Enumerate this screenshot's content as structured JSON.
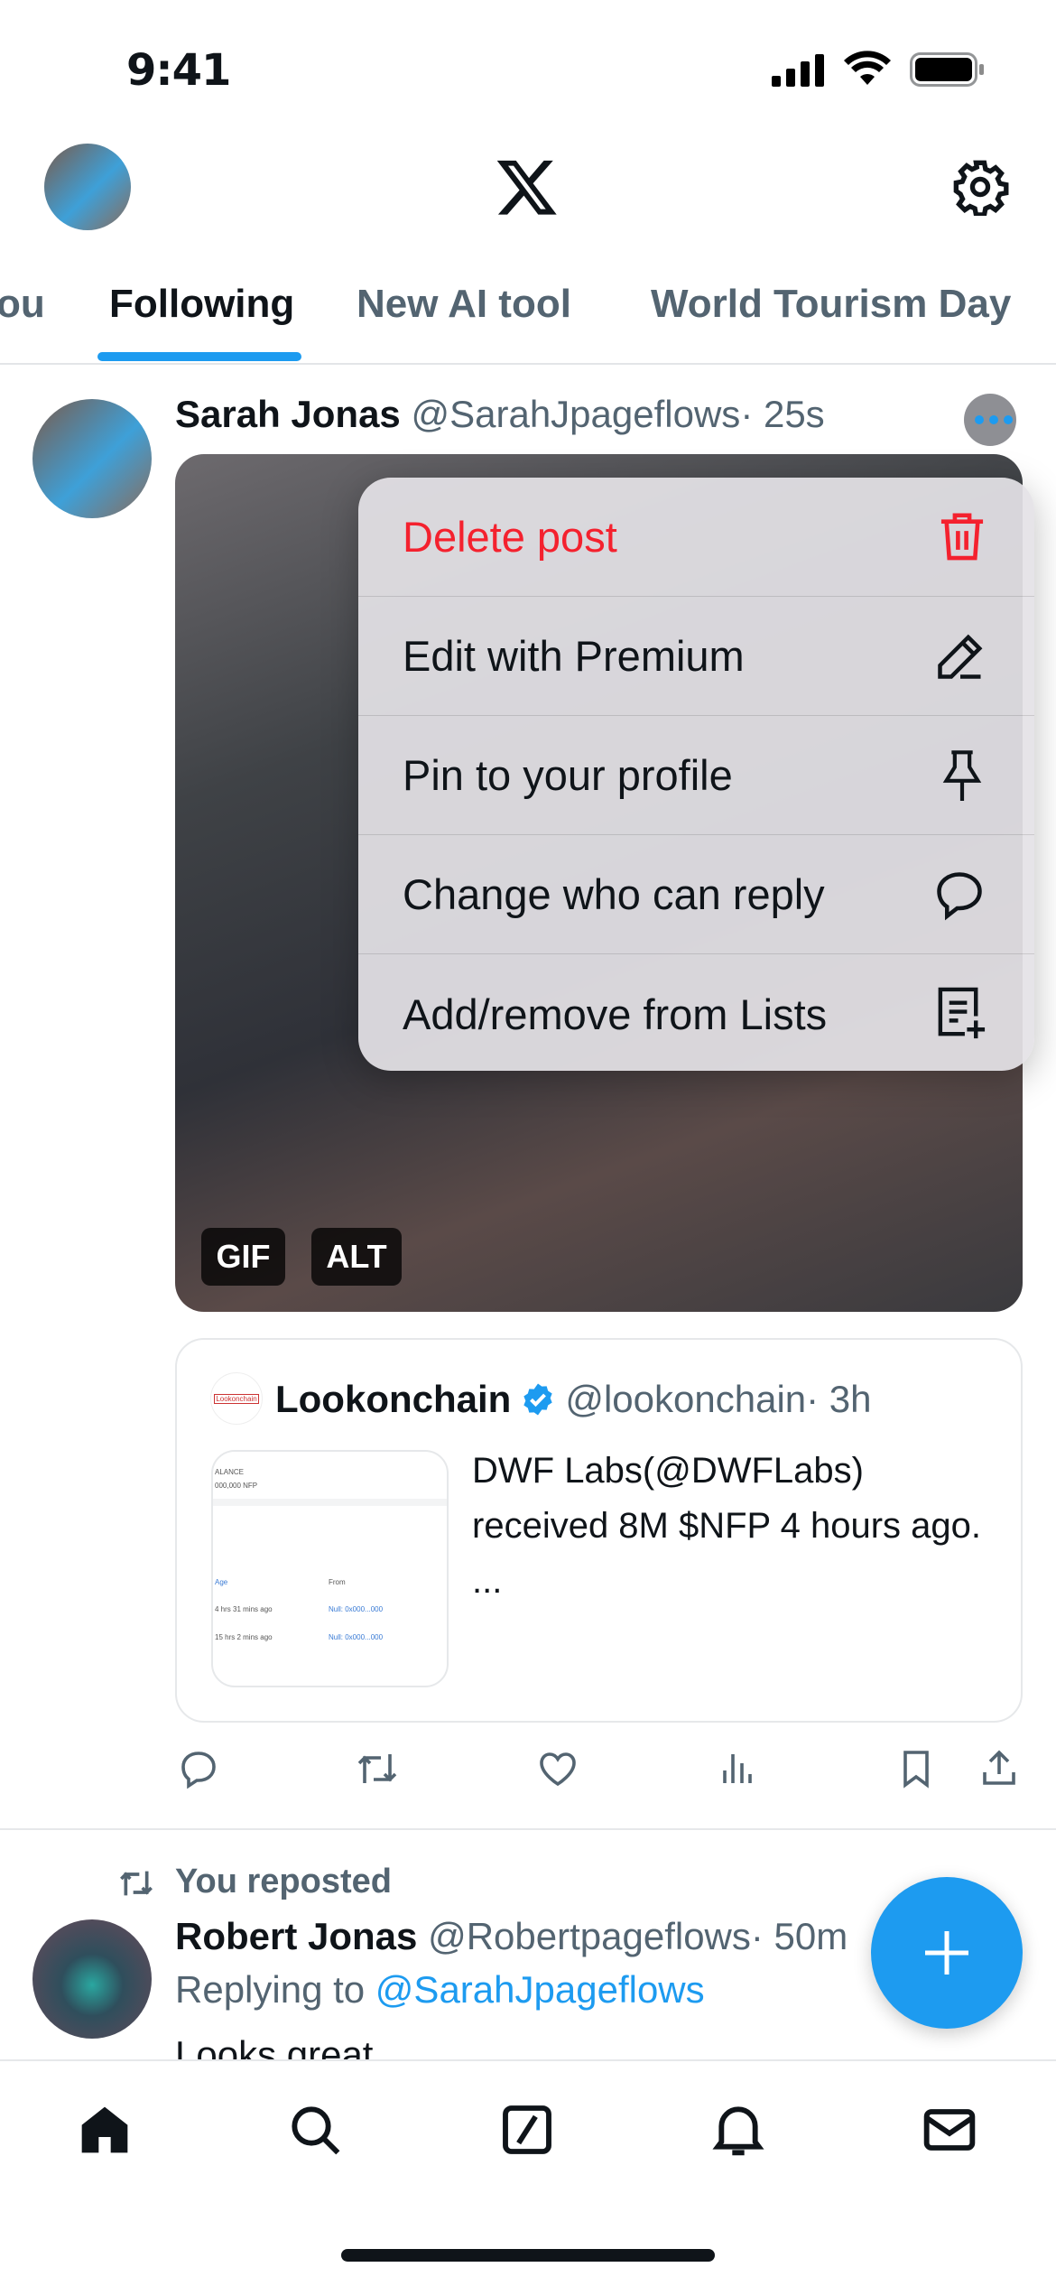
{
  "status_bar": {
    "time": "9:41"
  },
  "header": {
    "logo": "x-logo",
    "settings_icon": "gear-icon"
  },
  "tabs": [
    {
      "label": "For you",
      "visible": "ou"
    },
    {
      "label": "Following",
      "active": true
    },
    {
      "label": "New AI tool"
    },
    {
      "label": "World Tourism Day"
    }
  ],
  "post": {
    "name": "Sarah Jonas",
    "handle": "@SarahJpageflows",
    "time": "· 25s",
    "media_badges": [
      "GIF",
      "ALT"
    ],
    "quote": {
      "avatar_text": "Lookonchain",
      "name": "Lookonchain",
      "verified": true,
      "handle": "@lookonchain",
      "time": "· 3h",
      "text": "DWF Labs(@DWFLabs) received 8M $NFP 4 hours ago.",
      "ellipsis": "...",
      "thumb": {
        "l1": "ALANCE",
        "l2": "000,000 NFP",
        "h1": "Age",
        "h2": "From",
        "r1a": "4 hrs 31 mins ago",
        "r1b": "Null: 0x000...000",
        "r2a": "15 hrs 2 mins ago",
        "r2b": "Null: 0x000...000"
      }
    }
  },
  "menu": {
    "items": [
      {
        "label": "Delete post",
        "icon": "trash-icon",
        "danger": true
      },
      {
        "label": "Edit with Premium",
        "icon": "pencil-icon"
      },
      {
        "label": "Pin to your profile",
        "icon": "pin-icon"
      },
      {
        "label": "Change who can reply",
        "icon": "speech-bubble-icon"
      },
      {
        "label": "Add/remove from Lists",
        "icon": "list-add-icon"
      }
    ]
  },
  "repost": {
    "label": "You reposted",
    "name": "Robert Jonas",
    "handle": "@Robertpageflows",
    "time": "· 50m",
    "replying_prefix": "Replying to",
    "replying_to": "@SarahJpageflows",
    "text": "Looks great"
  },
  "colors": {
    "accent": "#1d9bf0",
    "danger": "#f4212e"
  }
}
